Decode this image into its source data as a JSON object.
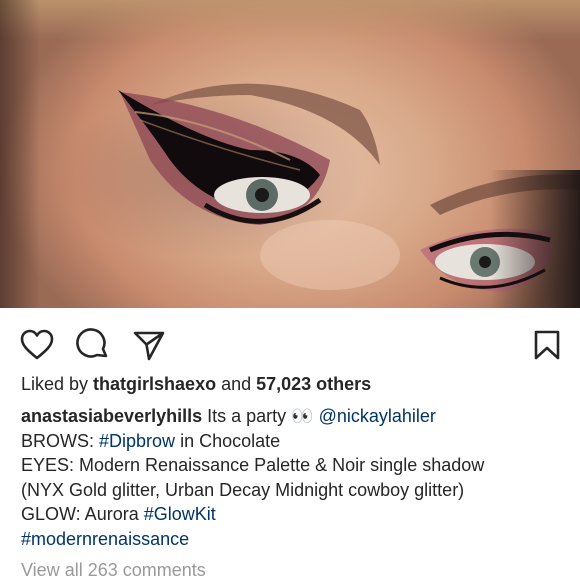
{
  "post": {
    "image_alt": "Close-up of eyes with black winged eyeliner, burgundy shadow and glitter"
  },
  "actions": {
    "like_icon": "heart-icon",
    "comment_icon": "comment-bubble-icon",
    "share_icon": "paper-plane-icon",
    "save_icon": "bookmark-icon"
  },
  "likes": {
    "prefix": "Liked by ",
    "user": "thatgirlshaexo",
    "middle": " and ",
    "count": "57,023 others"
  },
  "caption": {
    "author": "anastasiabeverlyhills",
    "text1": " Its a party ",
    "emoji": "👀",
    "mention": "@nickaylahiler",
    "brows_prefix": "BROWS: ",
    "brows_tag": "#Dipbrow",
    "brows_suffix": " in Chocolate",
    "eyes_line1": "EYES: Modern Renaissance Palette & Noir single shadow",
    "eyes_line2": "(NYX Gold glitter, Urban Decay Midnight cowboy glitter)",
    "glow_prefix": "GLOW: Aurora ",
    "glow_tag": "#GlowKit",
    "final_tag": "#modernrenaissance"
  },
  "comments": {
    "view_all": "View all 263 comments"
  },
  "colors": {
    "text": "#262626",
    "link": "#003569",
    "muted": "#999999"
  }
}
